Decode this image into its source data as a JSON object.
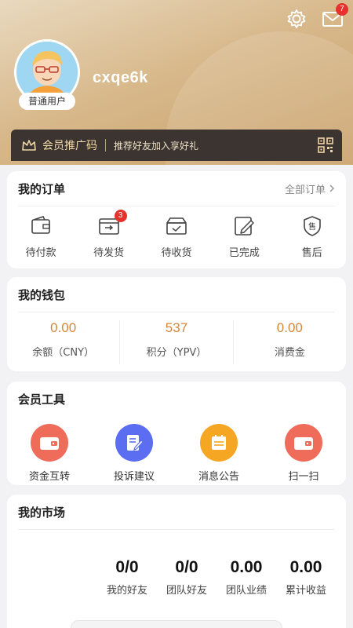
{
  "header": {
    "username": "cxqe6k",
    "level": "普通用户",
    "mail_badge": "7",
    "icons": [
      "gear-icon",
      "mail-icon"
    ]
  },
  "promo": {
    "title": "会员推广码",
    "desc": "推荐好友加入享好礼",
    "icons": [
      "crown-icon",
      "qrcode-icon"
    ]
  },
  "orders": {
    "title": "我的订单",
    "more": "全部订单",
    "items": [
      {
        "label": "待付款",
        "icon": "wallet-icon",
        "badge": ""
      },
      {
        "label": "待发货",
        "icon": "shipping-box-icon",
        "badge": "3"
      },
      {
        "label": "待收货",
        "icon": "receive-box-icon",
        "badge": ""
      },
      {
        "label": "已完成",
        "icon": "edit-doc-icon",
        "badge": ""
      },
      {
        "label": "售后",
        "icon": "after-sale-shield-icon",
        "badge": ""
      }
    ]
  },
  "wallet": {
    "title": "我的钱包",
    "items": [
      {
        "value": "0.00",
        "label": "余额（CNY）"
      },
      {
        "value": "537",
        "label": "积分（YPV）"
      },
      {
        "value": "0.00",
        "label": "消费金"
      }
    ]
  },
  "tools": {
    "title": "会员工具",
    "items": [
      {
        "label": "资金互转",
        "icon": "wallet-transfer-icon",
        "color": "#ef6b5a"
      },
      {
        "label": "投诉建议",
        "icon": "feedback-icon",
        "color": "#5b6df0"
      },
      {
        "label": "消息公告",
        "icon": "calendar-notice-icon",
        "color": "#f5a623"
      },
      {
        "label": "扫一扫",
        "icon": "scan-wallet-icon",
        "color": "#ef6b5a"
      }
    ]
  },
  "market": {
    "title": "我的市场",
    "items": [
      {
        "value": "0/0",
        "label": "我的好友"
      },
      {
        "value": "0/0",
        "label": "团队好友"
      },
      {
        "value": "0.00",
        "label": "团队业绩"
      },
      {
        "value": "0.00",
        "label": "累计收益"
      }
    ]
  },
  "colors": {
    "accent": "#d5863a",
    "badge": "#e5322d",
    "promo_bg": "#3b3430"
  }
}
